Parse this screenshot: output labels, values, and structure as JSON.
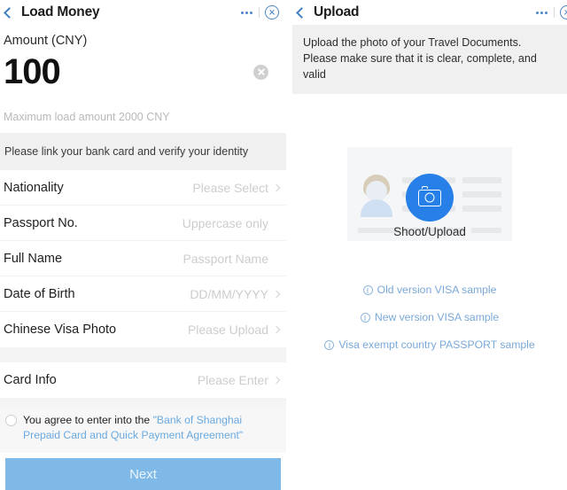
{
  "left": {
    "nav": {
      "back_icon": "chevron-left-icon",
      "title": "Load Money",
      "more_icon": "more-dots-icon",
      "target_icon": "target-close-icon"
    },
    "amount": {
      "label": "Amount (CNY)",
      "value": "100",
      "clear_icon": "clear-circle-icon",
      "hint": "Maximum load amount 2000 CNY"
    },
    "banner": "Please link your bank card and verify your identity",
    "rows": [
      {
        "label": "Nationality",
        "value": "Please Select",
        "chevron": true
      },
      {
        "label": "Passport No.",
        "value": "Uppercase only",
        "chevron": false
      },
      {
        "label": "Full Name",
        "value": "Passport Name",
        "chevron": false
      },
      {
        "label": "Date of Birth",
        "value": "DD/MM/YYYY",
        "chevron": true
      },
      {
        "label": "Chinese Visa Photo",
        "value": "Please Upload",
        "chevron": true
      }
    ],
    "card_info_row": {
      "label": "Card Info",
      "value": "Please Enter",
      "chevron": true
    },
    "agreement": {
      "text": "You agree to enter into the ",
      "link": "\"Bank of Shanghai Prepaid Card and Quick Payment Agreement\""
    },
    "next_label": "Next"
  },
  "right": {
    "nav": {
      "back_icon": "chevron-left-icon",
      "title": "Upload",
      "more_icon": "more-dots-icon",
      "target_icon": "target-close-icon"
    },
    "notice": "Upload the photo of your Travel Documents. Please make sure that it is clear, complete, and valid",
    "upload": {
      "avatar_icon": "person-avatar-icon",
      "camera_icon": "camera-icon",
      "shoot_label": "Shoot/Upload"
    },
    "samples": [
      {
        "icon": "info-icon",
        "label": "Old version VISA sample"
      },
      {
        "icon": "info-icon",
        "label": "New version VISA sample"
      },
      {
        "icon": "info-icon",
        "label": "Visa exempt country PASSPORT sample"
      }
    ]
  },
  "colors": {
    "accent_blue": "#2680e8",
    "button_blue": "#7fb9e8",
    "link_blue": "#7aa9d8",
    "nav_blue": "#3f7fc1",
    "banner_grey": "#f0f0f0"
  }
}
